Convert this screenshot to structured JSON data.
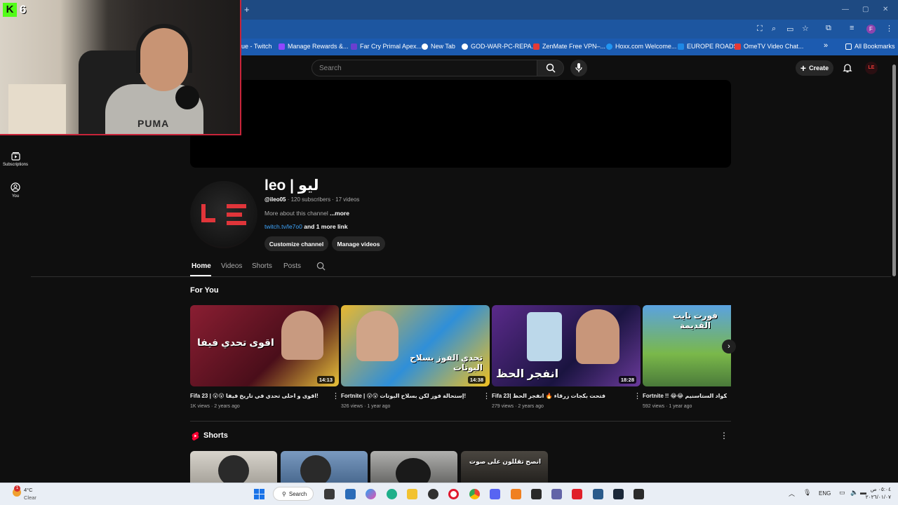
{
  "browser": {
    "new_tab_symbol": "+",
    "bookmarks": [
      {
        "label": "ue - Twitch",
        "color": "#9146ff"
      },
      {
        "label": "Manage Rewards &...",
        "color": "#9146ff"
      },
      {
        "label": "Far Cry Primal Apex...",
        "color": "#6a3fd0"
      },
      {
        "label": "New Tab",
        "color": "#ffffff"
      },
      {
        "label": "GOD-WAR-PC-REPA...",
        "color": "#ffffff"
      },
      {
        "label": "ZenMate Free VPN–...",
        "color": "#e53935"
      },
      {
        "label": "Hoxx.com Welcome...",
        "color": "#2196f3"
      },
      {
        "label": "EUROPE ROADS",
        "color": "#1e88e5"
      },
      {
        "label": "OmeTV Video Chat...",
        "color": "#e53935"
      }
    ],
    "more_bookmarks_symbol": "»",
    "all_bookmarks": "All Bookmarks",
    "profile_initial": "F"
  },
  "yt": {
    "search_placeholder": "Search",
    "create_label": "Create",
    "sidebar": [
      {
        "label": "Subscriptions",
        "icon": "subscriptions-icon"
      },
      {
        "label": "You",
        "icon": "you-icon"
      }
    ],
    "channel": {
      "name": "leo | ليو",
      "handle": "@ileo05",
      "stats": " · 120 subscribers · 17 videos",
      "about": "More about this channel ",
      "more": "...more",
      "link": "twitch.tv/le7o0",
      "more_links": " and 1 more link",
      "customize": "Customize channel",
      "manage": "Manage videos",
      "avatar_text": "LE"
    },
    "tabs": [
      "Home",
      "Videos",
      "Shorts",
      "Posts"
    ],
    "active_tab": "Home",
    "for_you_title": "For You",
    "videos": [
      {
        "title": "Fifa 23 | 😮😮 اقوى و احلى تحدي في تاريخ فيفا!",
        "meta": "1K views · 2 years ago",
        "duration": "14:13",
        "thumb_text": "اقوى تحدي فيفا",
        "bg": "#7a1c2c"
      },
      {
        "title": "Fortnite | 😮😮 إستحالة فوز لكن بسلاح البوتات!",
        "meta": "326 views · 1 year ago",
        "duration": "14:38",
        "thumb_text": "تحدي الفوز بسلاح البوتات",
        "bg": "#2f8fd8"
      },
      {
        "title": "Fifa 23| فتحت بكجات زرقاء 🔥 انفجر الحظ",
        "meta": "279 views · 2 years ago",
        "duration": "18:28",
        "thumb_text": "انفجر الحظ",
        "bg": "#3a2a6a"
      },
      {
        "title": "Fortnite !! 😂😂 إسكواد الستاسنيم",
        "meta": "592 views · 1 year ago",
        "duration": "",
        "thumb_text": "فورت نايت القديمة",
        "bg": "#4a8ac8"
      }
    ],
    "shorts_title": "Shorts",
    "shorts": [
      {
        "caption": "",
        "bg": "#c8c4bc"
      },
      {
        "caption": "",
        "bg": "#6a8ab0"
      },
      {
        "caption": "",
        "bg": "#9a9a98"
      },
      {
        "caption": "انصح تقللون على صوت",
        "bg": "#3a3835"
      }
    ]
  },
  "webcam": {
    "badge_letter": "K",
    "badge_number": "6",
    "shirt_text": "PUMA"
  },
  "taskbar": {
    "weather_temp": "4°C",
    "weather_desc": "Clear",
    "weather_badge": "1",
    "search_label": "Search",
    "lang": "ENG",
    "time": "٠٥:٠٤ ص",
    "date": "٢٠٢٦/٠١/٠٧"
  }
}
